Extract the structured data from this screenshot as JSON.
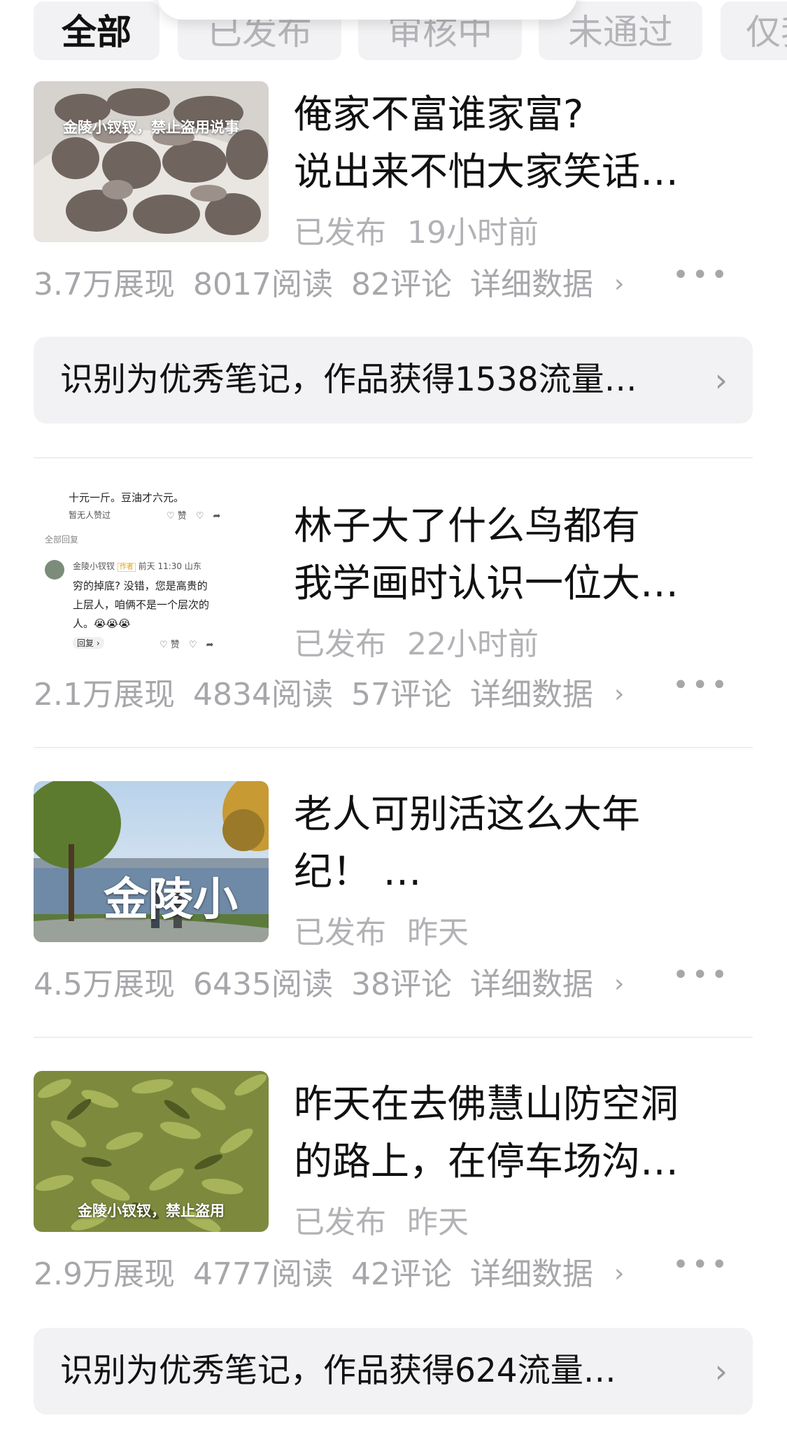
{
  "tabs": [
    {
      "label": "全部",
      "active": true
    },
    {
      "label": "已发布",
      "active": false
    },
    {
      "label": "审核中",
      "active": false
    },
    {
      "label": "未通过",
      "active": false
    },
    {
      "label": "仅我",
      "active": false
    }
  ],
  "posts": [
    {
      "thumb_text": "金陵小钗钗，禁止盗用说事",
      "title_line1": "俺家不富谁家富?",
      "title_line2": "说出来不怕大家笑话…",
      "status": "已发布",
      "time": "19小时前",
      "views": "3.7万展现",
      "reads": "8017阅读",
      "comments": "82评论",
      "detail": "详细数据",
      "banner": "识别为优秀笔记，作品获得1538流量…"
    },
    {
      "thumb": {
        "top_line": "十元一斤。豆油才六元。",
        "no_likes": "暂无人赞过",
        "like": "赞",
        "all_replies": "全部回复",
        "author": "金陵小钗钗",
        "author_tag": "作者",
        "time_loc": "前天 11:30 山东",
        "reply_line1": "穷的掉底? 没错，您是高贵的",
        "reply_line2": "上层人，咱俩不是一个层次的",
        "reply_line3": "人。😭😭😭",
        "reply_btn": "回复 ›",
        "like2": "赞"
      },
      "title_line1": "林子大了什么鸟都有",
      "title_line2": "我学画时认识一位大…",
      "status": "已发布",
      "time": "22小时前",
      "views": "2.1万展现",
      "reads": "4834阅读",
      "comments": "57评论",
      "detail": "详细数据"
    },
    {
      "thumb_text": "金陵小",
      "title_line1": "老人可别活这么大年",
      "title_line2": "纪！ …",
      "status": "已发布",
      "time": "昨天",
      "views": "4.5万展现",
      "reads": "6435阅读",
      "comments": "38评论",
      "detail": "详细数据"
    },
    {
      "thumb_text": "金陵小钗钗，禁止盗用",
      "title_line1": "昨天在去佛慧山防空洞",
      "title_line2": "的路上，在停车场沟…",
      "status": "已发布",
      "time": "昨天",
      "views": "2.9万展现",
      "reads": "4777阅读",
      "comments": "42评论",
      "detail": "详细数据",
      "banner": "识别为优秀笔记，作品获得624流量…"
    }
  ],
  "icons": {
    "more": "more-dots-icon",
    "chevron": "chevron-right-icon"
  },
  "chevron_glyph": "›",
  "more_glyph": "•••"
}
